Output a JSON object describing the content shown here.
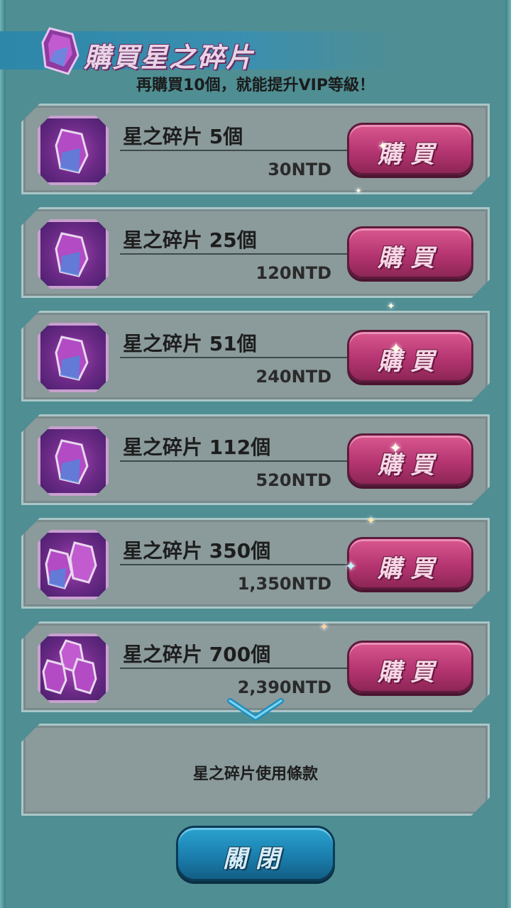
{
  "header": {
    "title": "購買星之碎片",
    "subtitle": "再購買10個，就能提升VIP等級！",
    "icon": "crystal-icon"
  },
  "items": [
    {
      "name": "星之碎片 5個",
      "price": "30NTD",
      "button": "購買",
      "icon": "crystal-icon"
    },
    {
      "name": "星之碎片 25個",
      "price": "120NTD",
      "button": "購買",
      "icon": "crystal-icon"
    },
    {
      "name": "星之碎片 51個",
      "price": "240NTD",
      "button": "購買",
      "icon": "crystal-icon"
    },
    {
      "name": "星之碎片 112個",
      "price": "520NTD",
      "button": "購買",
      "icon": "crystal-icon"
    },
    {
      "name": "星之碎片 350個",
      "price": "1,350NTD",
      "button": "購買",
      "icon": "crystal-pair-icon"
    },
    {
      "name": "星之碎片 700個",
      "price": "2,390NTD",
      "button": "購買",
      "icon": "crystal-trio-icon"
    }
  ],
  "terms": {
    "label": "星之碎片使用條款"
  },
  "close": {
    "label": "關閉"
  },
  "colors": {
    "background": "#4f8e93",
    "buy_button": "#b53571",
    "close_button": "#1b7fae",
    "card": "#8b9a9b"
  }
}
